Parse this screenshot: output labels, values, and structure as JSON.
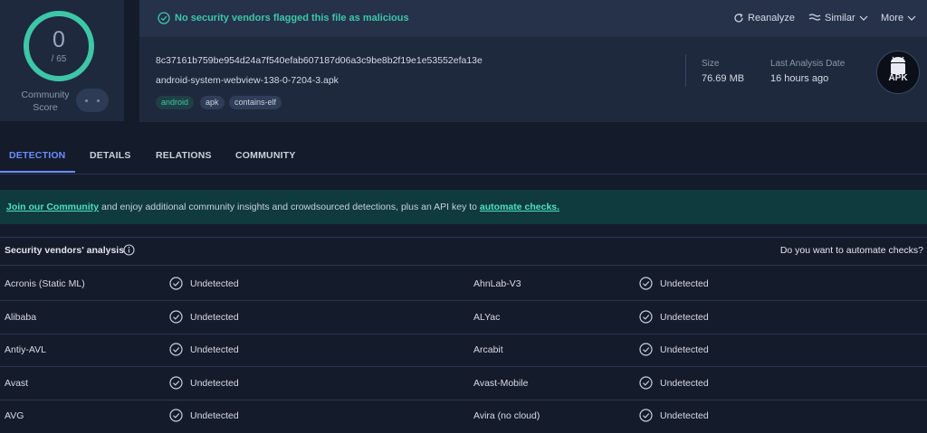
{
  "score": {
    "value": "0",
    "total": "/ 65",
    "label": "Community Score"
  },
  "header": {
    "status": "No security vendors flagged this file as malicious",
    "reanalyze_label": "Reanalyze",
    "similar_label": "Similar",
    "more_label": "More"
  },
  "file": {
    "hash": "8c37161b759be954d24a7f540efab607187d06a3c9be8b2f19e1e53552efa13e",
    "name": "android-system-webview-138-0-7204-3.apk",
    "tags": [
      "android",
      "apk",
      "contains-elf"
    ],
    "size_label": "Size",
    "size_value": "76.69 MB",
    "date_label": "Last Analysis Date",
    "date_value": "16 hours ago",
    "type_icon_label": "APK"
  },
  "tabs": [
    "DETECTION",
    "DETAILS",
    "RELATIONS",
    "COMMUNITY"
  ],
  "banner": {
    "link1": "Join our Community",
    "text": " and enjoy additional community insights and crowdsourced detections, plus an API key to ",
    "link2": "automate checks."
  },
  "analysis": {
    "title": "Security vendors' analysis",
    "automate_question": "Do you want to automate checks?",
    "rows": [
      {
        "v1": "Acronis (Static ML)",
        "r1": "Undetected",
        "v2": "AhnLab-V3",
        "r2": "Undetected"
      },
      {
        "v1": "Alibaba",
        "r1": "Undetected",
        "v2": "ALYac",
        "r2": "Undetected"
      },
      {
        "v1": "Antiy-AVL",
        "r1": "Undetected",
        "v2": "Arcabit",
        "r2": "Undetected"
      },
      {
        "v1": "Avast",
        "r1": "Undetected",
        "v2": "Avast-Mobile",
        "r2": "Undetected"
      },
      {
        "v1": "AVG",
        "r1": "Undetected",
        "v2": "Avira (no cloud)",
        "r2": "Undetected"
      }
    ]
  },
  "colors": {
    "accent": "#6c8cff",
    "clean": "#3ec6a8",
    "bg": "#141c2b"
  },
  "icons": [
    "check-circle-icon",
    "reanalyze-icon",
    "similar-icon",
    "chevron-down-icon",
    "info-icon",
    "android-icon"
  ]
}
